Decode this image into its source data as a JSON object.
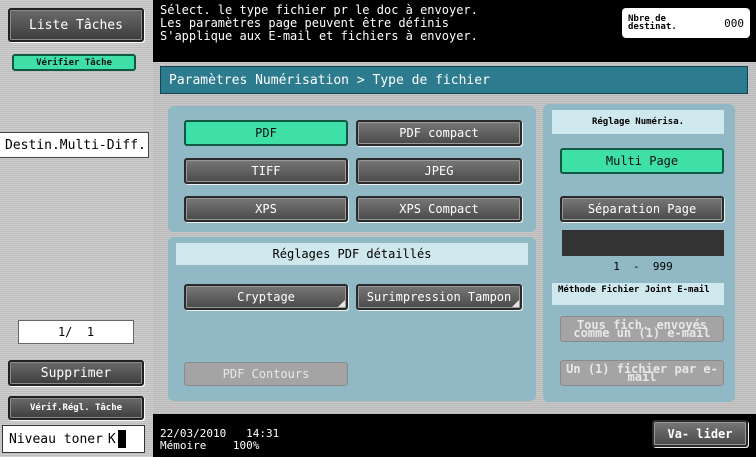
{
  "left": {
    "tasks_button": "Liste Tâches",
    "check_task_button": "Vérifier Tâche",
    "dest_tab": "Destin.Multi-Diff.",
    "page_indicator": "1/  1",
    "delete_button": "Supprimer",
    "check_settings_button": "Vérif.Régl. Tâche",
    "toner_label": "Niveau toner",
    "toner_level": "K"
  },
  "header": {
    "line1": "Sélect. le type fichier pr le doc à envoyer.",
    "line2": "Les paramètres page peuvent être définis",
    "line3": "S'applique aux E-mail et fichiers à envoyer.",
    "dest_count_label": "Nbre de destinat.",
    "dest_count_value": "000"
  },
  "breadcrumb": "Paramètres Numérisation > Type de fichier",
  "file_types": {
    "pdf": "PDF",
    "pdf_compact": "PDF compact",
    "tiff": "TIFF",
    "jpeg": "JPEG",
    "xps": "XPS",
    "xps_compact": "XPS Compact",
    "selected": "PDF"
  },
  "pdf_settings": {
    "title": "Réglages PDF détaillés",
    "encryption": "Cryptage",
    "stamp": "Surimpression Tampon",
    "outlines": "PDF Contours"
  },
  "scan_settings": {
    "title": "Réglage Numérisa.",
    "multi_page": "Multi Page",
    "page_separation": "Séparation Page",
    "range": "1  -  999"
  },
  "email_method": {
    "title": "Méthode Fichier Joint E-mail",
    "all_in_one": "Tous fich. envoyés comme un (1) e-mail",
    "one_per_mail": "Un (1) fichier par e-mail"
  },
  "footer": {
    "date": "22/03/2010",
    "time": "14:31",
    "memory_label": "Mémoire",
    "memory_value": "100%",
    "validate_button": "Va- lider"
  },
  "colors": {
    "selected_green": "#3ee0a8",
    "breadcrumb_teal": "#2c7b8e",
    "panel_blue": "#90b8c5"
  }
}
